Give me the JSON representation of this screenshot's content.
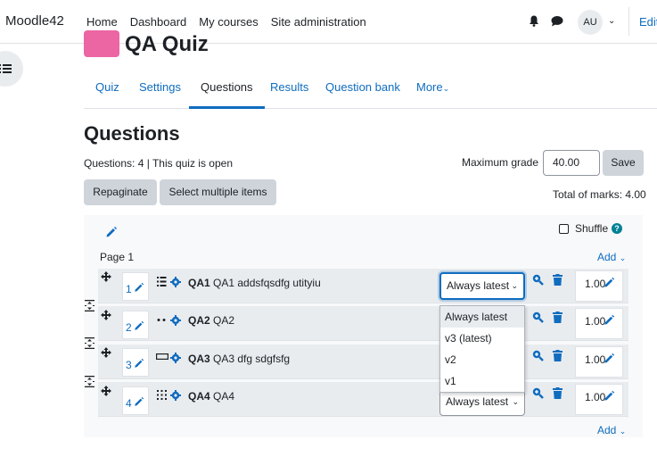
{
  "app": {
    "brand": "Moodle42",
    "edit_label": "Edit",
    "avatar_initials": "AU"
  },
  "nav": {
    "links": [
      "Home",
      "Dashboard",
      "My courses",
      "Site administration"
    ]
  },
  "quiz": {
    "title": "QA Quiz"
  },
  "tabs": [
    "Quiz",
    "Settings",
    "Questions",
    "Results",
    "Question bank",
    "More"
  ],
  "heading": "Questions",
  "info": "Questions: 4 | This quiz is open",
  "max_grade": {
    "label": "Maximum grade",
    "value": "40.00",
    "save": "Save"
  },
  "buttons": {
    "repaginate": "Repaginate",
    "select_multiple": "Select multiple items"
  },
  "total_marks": "Total of marks: 4.00",
  "shuffle_label": "Shuffle",
  "help_glyph": "?",
  "page_label": "Page 1",
  "add_label": "Add",
  "questions": [
    {
      "num": "1",
      "name": "QA1",
      "text": "QA1 addsfqsdfg utityiu",
      "version": "Always latest",
      "mark": "1.00"
    },
    {
      "num": "2",
      "name": "QA2",
      "text": "QA2",
      "version": "",
      "mark": "1.00"
    },
    {
      "num": "3",
      "name": "QA3",
      "text": "QA3 dfg sdgfsfg",
      "version": "",
      "mark": "1.00"
    },
    {
      "num": "4",
      "name": "QA4",
      "text": "QA4",
      "version": "Always latest",
      "mark": "1.00"
    }
  ],
  "version_options": [
    "Always latest",
    "v3 (latest)",
    "v2",
    "v1"
  ],
  "colors": {
    "accent": "#0f6cbf",
    "quiz_icon": "#eb66a2",
    "help": "#008196"
  }
}
